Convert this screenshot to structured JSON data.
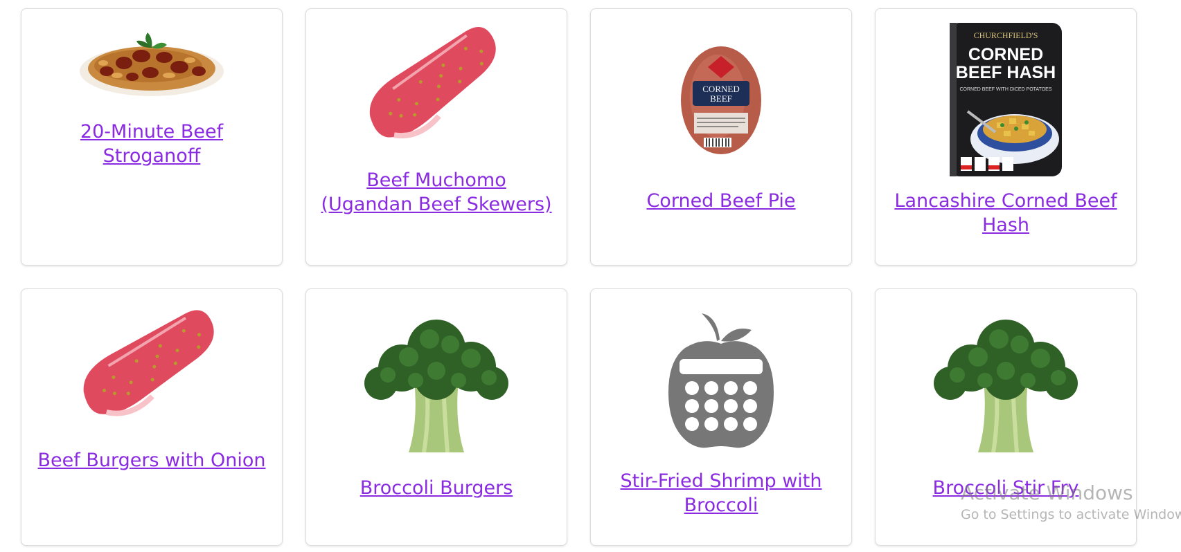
{
  "recipes": [
    {
      "title": "20-Minute Beef Stroganoff",
      "image": "beef-stroganoff-plate"
    },
    {
      "title": "Beef Muchomo (Ugandan Beef Skewers)",
      "image": "raw-steak"
    },
    {
      "title": "Corned Beef Pie",
      "image": "corned-beef-package"
    },
    {
      "title": "Lancashire Corned Beef Hash",
      "image": "corned-beef-hash-can"
    },
    {
      "title": "Beef Burgers with Onion",
      "image": "raw-steak"
    },
    {
      "title": "Broccoli Burgers",
      "image": "broccoli"
    },
    {
      "title": "Stir-Fried Shrimp with Broccoli",
      "image": "apple-calculator-placeholder"
    },
    {
      "title": "Broccoli Stir Fry",
      "image": "broccoli"
    }
  ],
  "can_label": {
    "brand": "CHURCHFIELD'S",
    "line1": "CORNED",
    "line2": "BEEF HASH",
    "subtitle": "CORNED BEEF WITH DICED POTATOES"
  },
  "package_label": {
    "line1": "CORNED",
    "line2": "BEEF"
  },
  "watermark": {
    "line1": "Activate Windows",
    "line2": "Go to Settings to activate Windows."
  },
  "colors": {
    "link": "#8a2be2",
    "card_border": "#dcdcdc"
  }
}
